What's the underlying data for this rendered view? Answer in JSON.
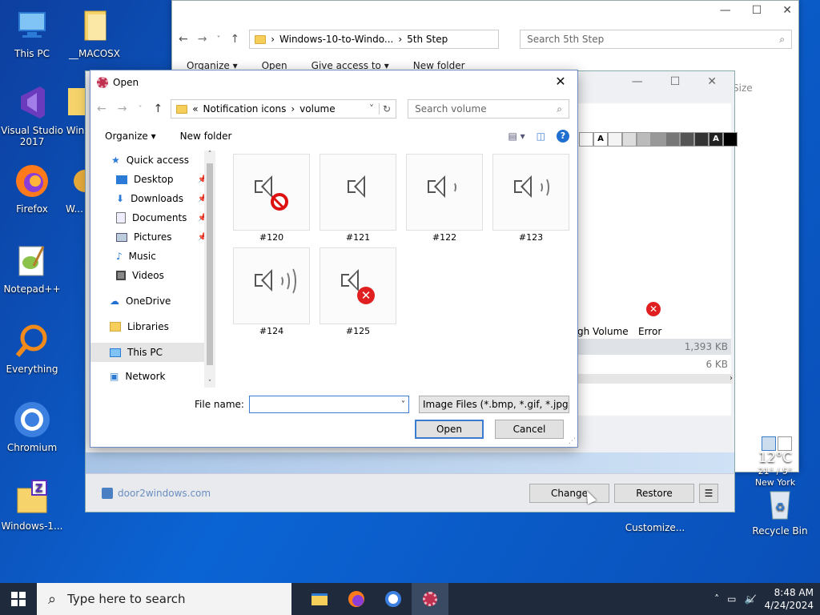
{
  "desktop": {
    "icons": [
      {
        "label": "This PC",
        "icon": "computer-icon"
      },
      {
        "label": "__MACOSX",
        "icon": "folder-icon"
      },
      {
        "label": "Visual Studio 2017",
        "icon": "visual-studio-icon"
      },
      {
        "label": "Win",
        "icon": "folder-icon"
      },
      {
        "label": "Firefox",
        "icon": "firefox-icon"
      },
      {
        "label": "W... T...",
        "icon": "app-icon"
      },
      {
        "label": "Notepad++",
        "icon": "notepad-plus-plus-icon"
      },
      {
        "label": "Everything",
        "icon": "magnifier-icon"
      },
      {
        "label": "Chromium",
        "icon": "chromium-icon"
      },
      {
        "label": "Windows-1...",
        "icon": "zip-folder-icon"
      },
      {
        "label": "Customize...",
        "icon": "app-icon"
      },
      {
        "label": "Recycle Bin",
        "icon": "recycle-bin-icon"
      }
    ]
  },
  "explorer": {
    "breadcrumb": [
      "Windows-10-to-Windo...",
      "5th Step"
    ],
    "search_placeholder": "Search 5th Step",
    "toolbar": [
      "Organize ▾",
      "Open",
      "Give access to ▾",
      "New folder"
    ],
    "size_header": "Size"
  },
  "app_window": {
    "palette_letters": [
      "A",
      "A"
    ],
    "items": [
      {
        "label": "gh Volume"
      },
      {
        "label": "Error"
      }
    ],
    "sizes": [
      "1,393 KB",
      "6 KB"
    ],
    "footer": {
      "link": "door2windows.com",
      "change_label": "Change",
      "restore_label": "Restore"
    }
  },
  "weather": {
    "temp": "12°C",
    "range": "21° / 5°",
    "city": "New York"
  },
  "dialog": {
    "title": "Open",
    "breadcrumb": [
      "«",
      "Notification icons",
      "volume"
    ],
    "search_placeholder": "Search volume",
    "organize_label": "Organize ▾",
    "new_folder_label": "New folder",
    "sidebar": [
      {
        "label": "Quick access",
        "icon": "star-icon",
        "pinned": false,
        "indent": 0
      },
      {
        "label": "Desktop",
        "icon": "desktop-icon",
        "pinned": true,
        "indent": 1
      },
      {
        "label": "Downloads",
        "icon": "download-icon",
        "pinned": true,
        "indent": 1
      },
      {
        "label": "Documents",
        "icon": "document-icon",
        "pinned": true,
        "indent": 1
      },
      {
        "label": "Pictures",
        "icon": "pictures-icon",
        "pinned": true,
        "indent": 1
      },
      {
        "label": "Music",
        "icon": "music-icon",
        "pinned": false,
        "indent": 1
      },
      {
        "label": "Videos",
        "icon": "video-icon",
        "pinned": false,
        "indent": 1
      },
      {
        "label": "OneDrive",
        "icon": "cloud-icon",
        "pinned": false,
        "indent": 0
      },
      {
        "label": "Libraries",
        "icon": "library-icon",
        "pinned": false,
        "indent": 0
      },
      {
        "label": "This PC",
        "icon": "computer-icon",
        "pinned": false,
        "indent": 0
      },
      {
        "label": "Network",
        "icon": "network-icon",
        "pinned": false,
        "indent": 0
      }
    ],
    "files": [
      {
        "label": "#120",
        "variant": "muted"
      },
      {
        "label": "#121",
        "variant": "speaker"
      },
      {
        "label": "#122",
        "variant": "low"
      },
      {
        "label": "#123",
        "variant": "medium"
      },
      {
        "label": "#124",
        "variant": "high"
      },
      {
        "label": "#125",
        "variant": "error"
      }
    ],
    "file_name_label": "File name:",
    "file_name_value": "",
    "file_type": "Image Files (*.bmp, *.gif, *.jpg,",
    "open_label": "Open",
    "cancel_label": "Cancel"
  },
  "taskbar": {
    "search_placeholder": "Type here to search",
    "apps": [
      "file-explorer-icon",
      "firefox-icon",
      "chromium-icon",
      "settings-gear-icon"
    ],
    "time": "8:48 AM",
    "date": "4/24/2024"
  }
}
